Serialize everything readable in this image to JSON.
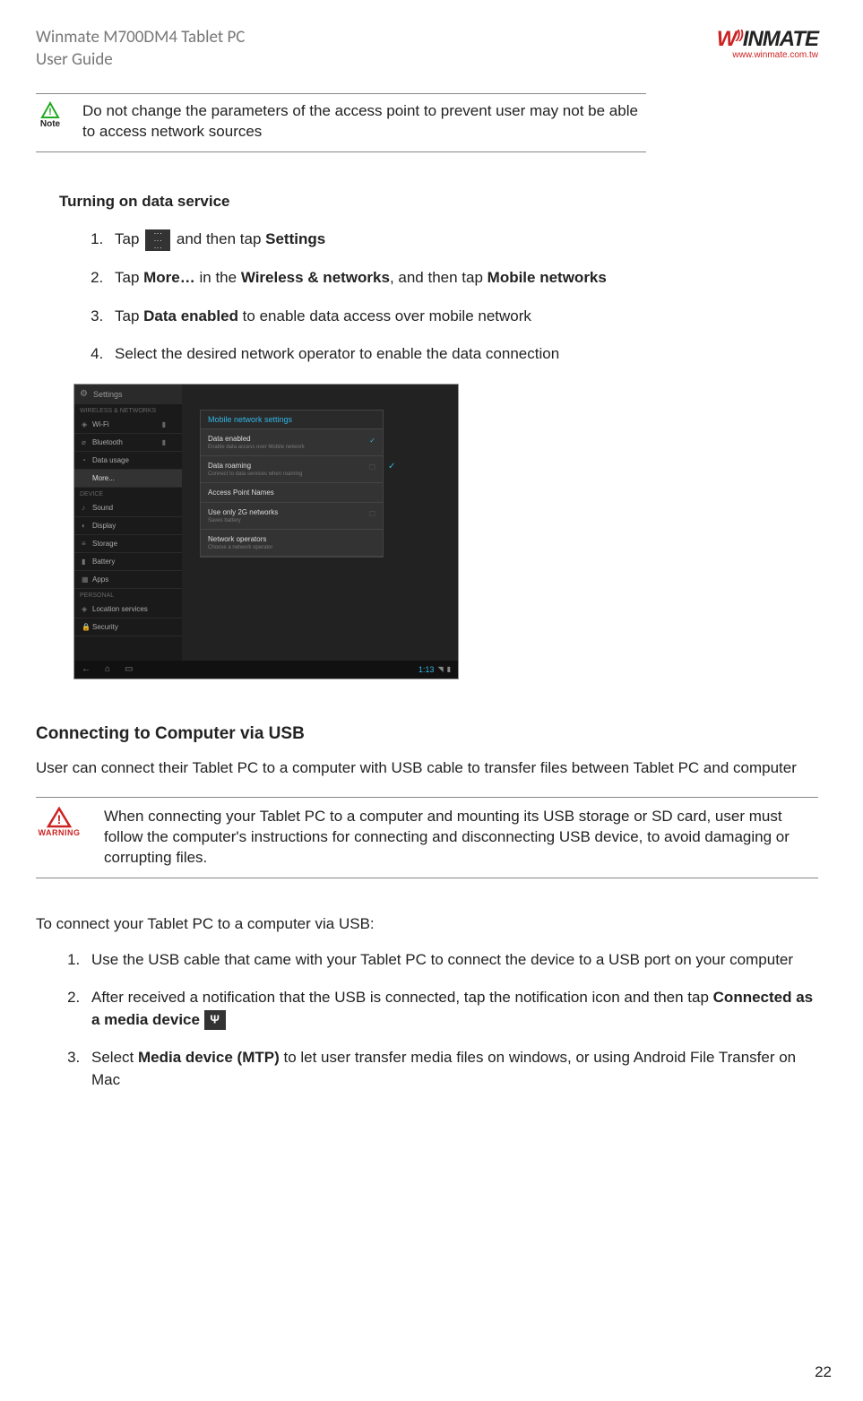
{
  "header": {
    "product": "Winmate M700DM4 Tablet PC",
    "doc": "User Guide",
    "logo_text": "WINMATE",
    "logo_url": "www.winmate.com.tw"
  },
  "note": {
    "label": "Note",
    "text": "Do not change the parameters of the access point to prevent user may not be able to access network sources"
  },
  "section1": {
    "heading": "Turning on data service",
    "step1_a": "Tap ",
    "step1_b": " and then tap ",
    "step1_bold": "Settings",
    "step2_a": "Tap ",
    "step2_b1": "More…",
    "step2_c": " in the ",
    "step2_b2": "Wireless & networks",
    "step2_d": ", and then tap ",
    "step2_b3": "Mobile networks",
    "step3_a": "Tap ",
    "step3_b": "Data enabled",
    "step3_c": " to enable data access over mobile network",
    "step4": "Select the desired network operator to enable the data connection"
  },
  "screenshot": {
    "title": "Settings",
    "cat1": "WIRELESS & NETWORKS",
    "wifi": "Wi-Fi",
    "bluetooth": "Bluetooth",
    "datausage": "Data usage",
    "more": "More...",
    "cat2": "DEVICE",
    "sound": "Sound",
    "display": "Display",
    "storage": "Storage",
    "battery": "Battery",
    "apps": "Apps",
    "cat3": "PERSONAL",
    "location": "Location services",
    "security": "Security",
    "popup_title": "Mobile network settings",
    "p1_title": "Data enabled",
    "p1_sub": "Enable data access over Mobile network",
    "p2_title": "Data roaming",
    "p2_sub": "Connect to data services when roaming",
    "p3_title": "Access Point Names",
    "p4_title": "Use only 2G networks",
    "p4_sub": "Saves battery",
    "p5_title": "Network operators",
    "p5_sub": "Choose a network operator",
    "time": "1:13"
  },
  "section2": {
    "heading": "Connecting to Computer via USB",
    "intro": "User can connect their Tablet PC to a computer with USB cable to transfer files between Tablet PC and computer"
  },
  "warning": {
    "label": "WARNING",
    "text": "When connecting your Tablet PC to a computer and mounting its USB storage or SD card, user must follow the computer's instructions for connecting and disconnecting USB device, to avoid damaging or corrupting files."
  },
  "section3": {
    "intro": "To connect your Tablet PC to a computer via USB:",
    "step1": "Use the USB cable that came with your Tablet PC to connect the device to a USB port on your computer",
    "step2_a": "After received a notification that the USB is connected, tap the notification icon and then tap ",
    "step2_b": "Connected as a media device ",
    "step3_a": "Select ",
    "step3_b": "Media device (MTP)",
    "step3_c": " to let user transfer media files on windows, or using Android File Transfer on Mac"
  },
  "page_number": "22"
}
